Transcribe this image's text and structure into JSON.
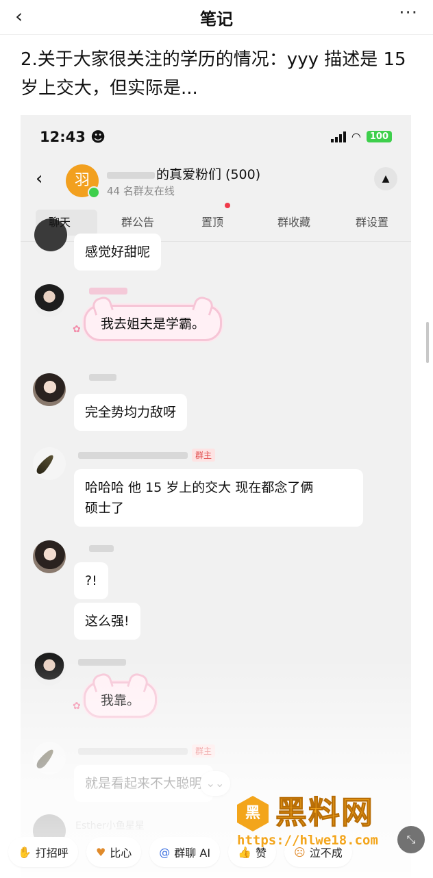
{
  "topbar": {
    "back_icon": "‹",
    "title": "笔记",
    "more_icon": "···"
  },
  "note": {
    "text": "2.关于大家很关注的学历的情况：yyy 描述是 15 岁上交大，但实际是..."
  },
  "screenshot": {
    "status": {
      "time": "12:43",
      "face_icon": "☻",
      "wifi_icon": "◠",
      "battery": "100"
    },
    "group": {
      "back_icon": "‹",
      "avatar_char": "羽",
      "name": "的真爱粉们 (500)",
      "online": "44 名群友在线",
      "collapse_icon": "▲"
    },
    "tabs": [
      "聊天",
      "群公告",
      "置顶",
      "群收藏",
      "群设置"
    ],
    "messages": {
      "m1": "感觉好甜呢",
      "m2": "我去姐夫是学霸。",
      "m3": "完全势均力敌呀",
      "admin_badge": "群主",
      "m4_line1": "哈哈哈 他 15 岁上的交大 现在都念了俩",
      "m4_line2": "硕士了",
      "m5": "?!",
      "m6": "这么强!",
      "m7": "我靠。",
      "m8": "就是看起来不大聪明",
      "sender_last": "Esther小鱼星星"
    },
    "scroll_icon": "⌄⌄"
  },
  "quick_actions": [
    {
      "icon": "✋",
      "label": "打招呼"
    },
    {
      "icon": "♥",
      "label": "比心"
    },
    {
      "icon": "@",
      "label": "群聊 AI"
    },
    {
      "icon": "👍",
      "label": "赞"
    },
    {
      "icon": "☹",
      "label": "泣不成"
    }
  ],
  "watermark": {
    "logo_char": "黑",
    "brand": "黑料网",
    "url": "https://hlwe18.com"
  },
  "expand_icon": "⤡"
}
